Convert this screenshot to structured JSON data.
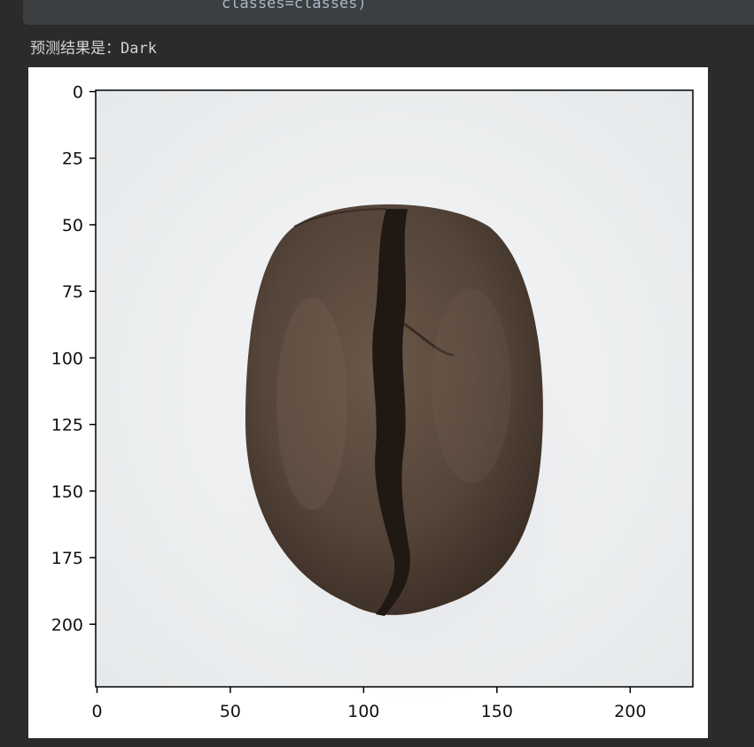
{
  "code_cell": {
    "line": "classes=classes)"
  },
  "output": {
    "prefix": "预测结果是：",
    "prediction": "Dark"
  },
  "chart_data": {
    "type": "image",
    "x": {
      "ticks": [
        0,
        50,
        100,
        150,
        200
      ],
      "lim": [
        -0.5,
        223.5
      ]
    },
    "y": {
      "ticks": [
        0,
        25,
        50,
        75,
        100,
        125,
        150,
        175,
        200
      ],
      "lim": [
        223.5,
        -0.5
      ],
      "inverted": true
    },
    "colors": {
      "background": "#eef0f1",
      "bean": "#5a4a3c",
      "bean_dark": "#3a2d22",
      "crease": "#1e1712"
    }
  }
}
